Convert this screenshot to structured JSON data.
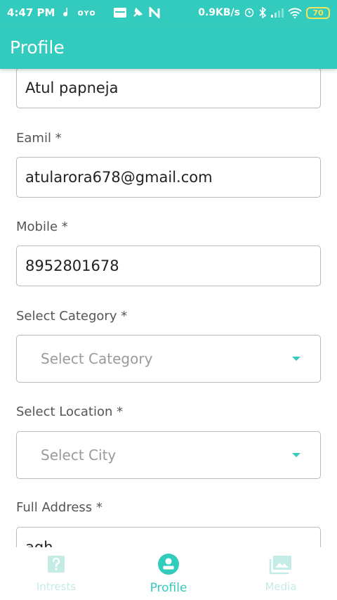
{
  "status_bar": {
    "time": "4:47 PM",
    "app_glyph": "oʏo",
    "speed": "0.9KB/s",
    "battery": "70"
  },
  "app_bar": {
    "title": "Profile"
  },
  "form": {
    "name_value": "Atul papneja",
    "email_label": "Eamil *",
    "email_value": "atularora678@gmail.com",
    "mobile_label": "Mobile *",
    "mobile_value": "8952801678",
    "category_label": "Select Category *",
    "category_placeholder": "Select Category",
    "location_label": "Select Location *",
    "location_placeholder": "Select City",
    "address_label": "Full Address *",
    "address_value": "agh"
  },
  "bottom_nav": {
    "items": [
      {
        "label": "Intrests",
        "icon": "question-icon"
      },
      {
        "label": "Profile",
        "icon": "person-icon"
      },
      {
        "label": "Media",
        "icon": "gallery-icon"
      }
    ]
  },
  "colors": {
    "accent": "#33cbbd",
    "inactive_nav": "#c3ece7",
    "border": "#b9b9b9"
  }
}
